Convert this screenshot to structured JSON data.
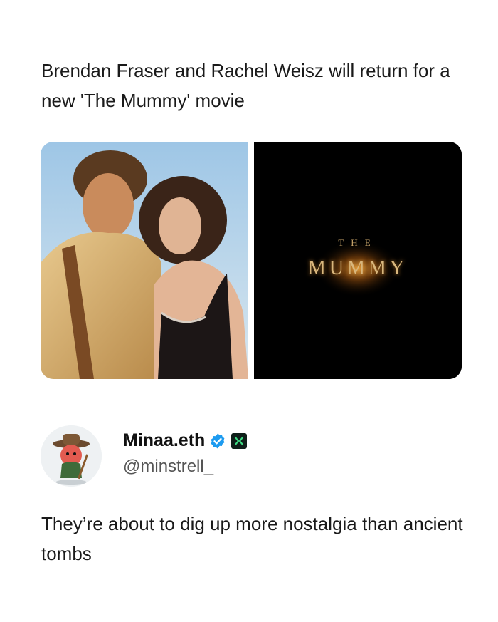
{
  "headline": "Brendan Fraser and Rachel Weisz will return for a new 'The Mummy' movie",
  "media": {
    "left_image": "movie-still-couple",
    "right_image": "the-mummy-logo",
    "logo_the": "THE",
    "logo_mummy": "MUMMY"
  },
  "author": {
    "display_name": "Minaa.eth",
    "handle": "@minstrell_",
    "avatar": "cartoon-explorer-avatar",
    "badges": [
      "verified-icon",
      "app-badge-icon"
    ]
  },
  "tweet": {
    "text": "They’re about to dig up more nostalgia than ancient tombs"
  },
  "colors": {
    "text": "#1a1a1a",
    "handle": "#555555",
    "verified": "#1d9bf0",
    "logo_gold": "#d9b77d"
  }
}
